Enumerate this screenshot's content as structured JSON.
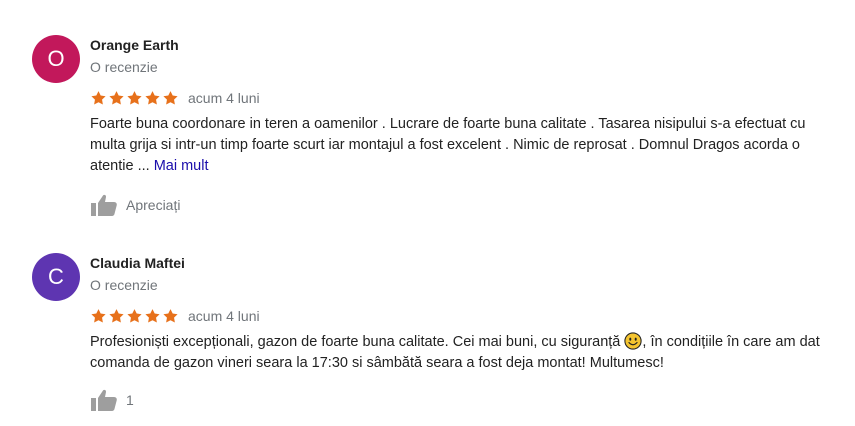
{
  "reviews": [
    {
      "avatar_letter": "O",
      "avatar_color": "#c2185b",
      "author": "Orange Earth",
      "review_count": "O recenzie",
      "stars": 5,
      "time": "acum 4 luni",
      "text": "Foarte buna coordonare in teren a oamenilor . Lucrare de foarte buna calitate . Tasarea nisipului s-a efectuat cu multa grija si intr-un timp foarte scurt iar montajul a fost excelent . Nimic de reprosat . Domnul Dragos acorda o atentie",
      "ellipsis": " ... ",
      "more_label": "Mai mult",
      "like_label": "Apreciați"
    },
    {
      "avatar_letter": "C",
      "avatar_color": "#5e35b1",
      "author": "Claudia Maftei",
      "review_count": "O recenzie",
      "stars": 5,
      "time": "acum 4 luni",
      "text_before_emoji": "Profesioniști excepționali, gazon de foarte buna calitate. Cei mai buni, cu siguranță",
      "emoji_icon": "smiling-face-emoji",
      "text_after_emoji": ", în condițiile în care am dat comanda de gazon vineri seara la 17:30 si sâmbătă seara a fost deja montat! Multumesc!",
      "like_count": "1"
    }
  ],
  "colors": {
    "star": "#e7711b",
    "muted_text": "#70757a",
    "link": "#1a0dab",
    "thumb": "#9e9e9e"
  }
}
